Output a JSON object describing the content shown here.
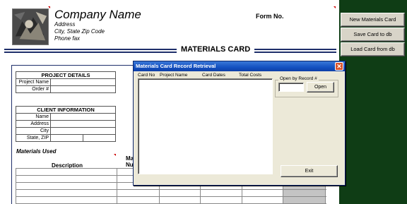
{
  "header": {
    "company_name": "Company Name",
    "address_lines": [
      "Address",
      "City, State  Zip Code",
      "Phone fax"
    ],
    "form_no_label": "Form No.",
    "card_title": "MATERIALS CARD"
  },
  "project_details": {
    "title": "PROJECT DETAILS",
    "fields": [
      "Project Name",
      "Order #"
    ]
  },
  "client_information": {
    "title": "CLIENT INFORMATION",
    "fields": [
      "Name",
      "Address",
      "City",
      "State, ZIP"
    ]
  },
  "materials": {
    "section_label": "Materials Used",
    "col_description": "Description",
    "col_partial_line1": "Ma",
    "col_partial_line2": "Nu"
  },
  "side_buttons": {
    "new_card": "New Materials Card",
    "save_card": "Save Card to db",
    "load_card": "Load Card from db"
  },
  "dialog": {
    "title": "Materials Card Record Retrieval",
    "close_glyph": "✕",
    "columns": [
      "Card No",
      "Project Name",
      "Card Dates",
      "Total Costs"
    ],
    "open_by_record_label": "Open by Record #",
    "record_value": "",
    "open_button": "Open",
    "exit_button": "Exit"
  },
  "colors": {
    "desktop_bg": "#0f3d15",
    "title_rule": "#1f2f6b",
    "dialog_titlebar": "#1450c0",
    "dialog_face": "#ece9d8",
    "close_button": "#d9532c",
    "marker": "#cc0000"
  }
}
